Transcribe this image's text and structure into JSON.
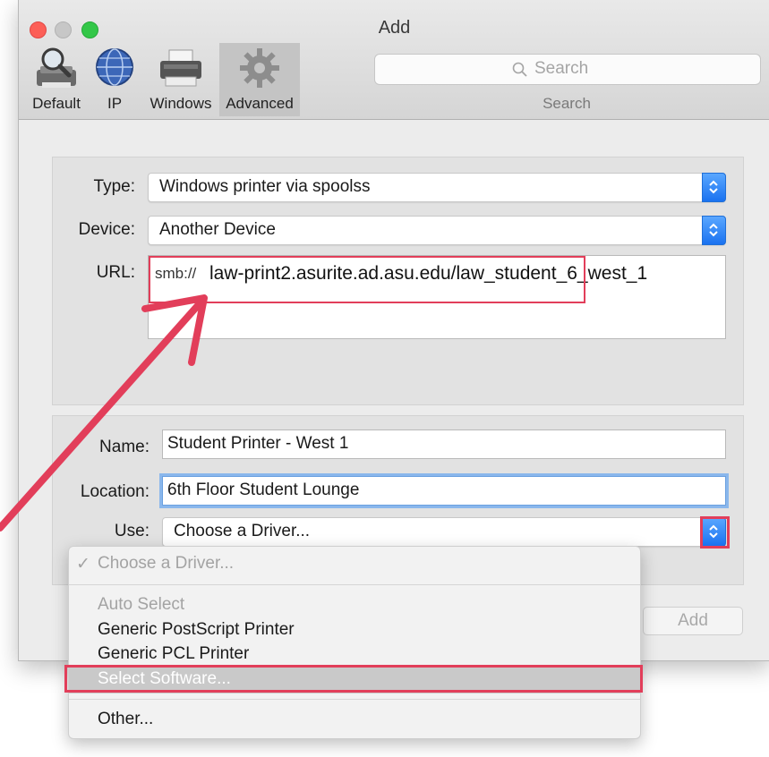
{
  "window": {
    "title": "Add"
  },
  "toolbar": {
    "items": [
      {
        "label": "Default",
        "icon": "default-printer-icon"
      },
      {
        "label": "IP",
        "icon": "ip-globe-icon"
      },
      {
        "label": "Windows",
        "icon": "windows-printer-icon"
      },
      {
        "label": "Advanced",
        "icon": "gear-icon",
        "active": true
      }
    ],
    "search_placeholder": "Search",
    "search_caption": "Search"
  },
  "form": {
    "type_label": "Type:",
    "type_value": "Windows printer via spoolss",
    "device_label": "Device:",
    "device_value": "Another Device",
    "url_label": "URL:",
    "url_prefix": "smb://",
    "url_rest": "law-print2.asurite.ad.asu.edu/law_student_6_west_1",
    "name_label": "Name:",
    "name_value": "Student Printer - West 1",
    "location_label": "Location:",
    "location_value": "6th Floor Student Lounge",
    "use_label": "Use:",
    "use_value": "Choose a Driver..."
  },
  "menu": {
    "checked_item": "Choose a Driver...",
    "items": [
      {
        "label": "Auto Select",
        "enabled": false
      },
      {
        "label": "Generic PostScript Printer",
        "enabled": true
      },
      {
        "label": "Generic PCL Printer",
        "enabled": true
      },
      {
        "label": "Select Software...",
        "enabled": true,
        "highlighted": true
      },
      {
        "label": "Other...",
        "enabled": true
      }
    ]
  },
  "buttons": {
    "add_label": "Add"
  },
  "colors": {
    "annotation_red": "#e23e5a",
    "accent_blue": "#1a72f0"
  }
}
